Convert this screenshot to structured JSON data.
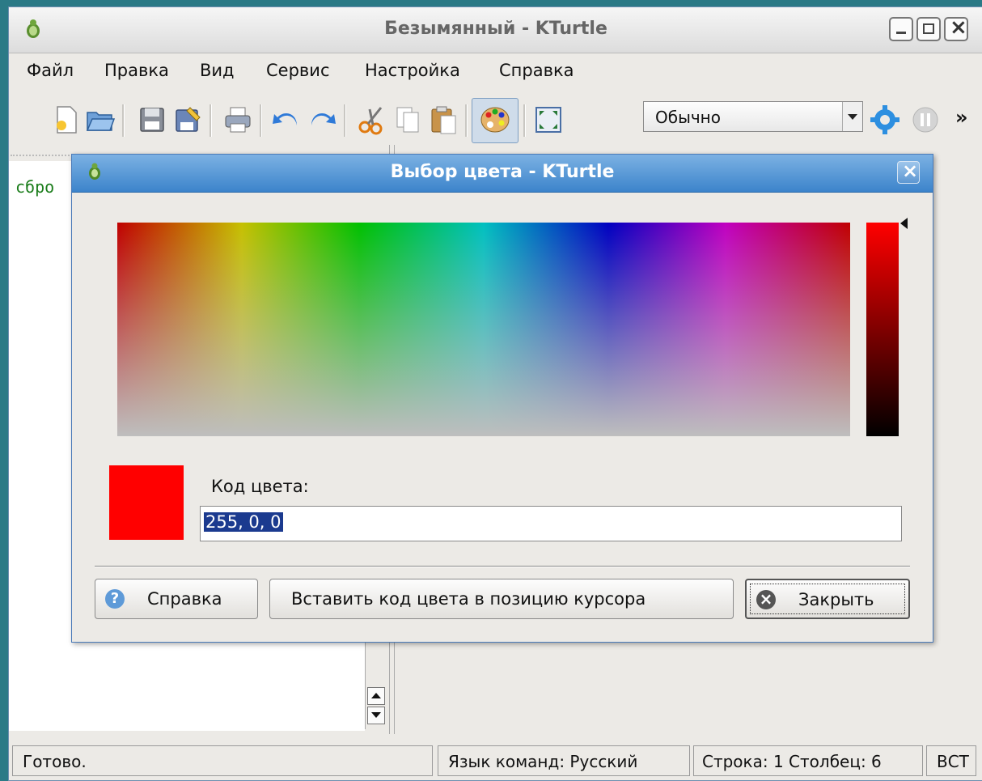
{
  "window": {
    "title": "Безымянный - KTurtle"
  },
  "menubar": {
    "items": [
      {
        "label": "Файл"
      },
      {
        "label": "Правка"
      },
      {
        "label": "Вид"
      },
      {
        "label": "Сервис"
      },
      {
        "label": "Настройка"
      },
      {
        "label": "Справка"
      }
    ]
  },
  "toolbar": {
    "speed_value": "Обычно",
    "overflow": "»"
  },
  "editor": {
    "code_fragment": "сбро"
  },
  "dialog": {
    "title": "Выбор цвета - KTurtle",
    "code_label": "Код цвета:",
    "code_value": "255, 0, 0",
    "selected_color": "#ff0000",
    "help_button": "Справка",
    "insert_button": "Вставить код цвета в позицию курсора",
    "close_button": "Закрыть"
  },
  "statusbar": {
    "status": "Готово.",
    "language": "Язык команд: Русский",
    "position": "Строка: 1 Столбец: 6",
    "mode": "ВСТ"
  },
  "colors": {
    "dialog_title_bar": "#3c84cb",
    "selection": "#1b3a8f",
    "code_text": "#1b7d1b"
  }
}
